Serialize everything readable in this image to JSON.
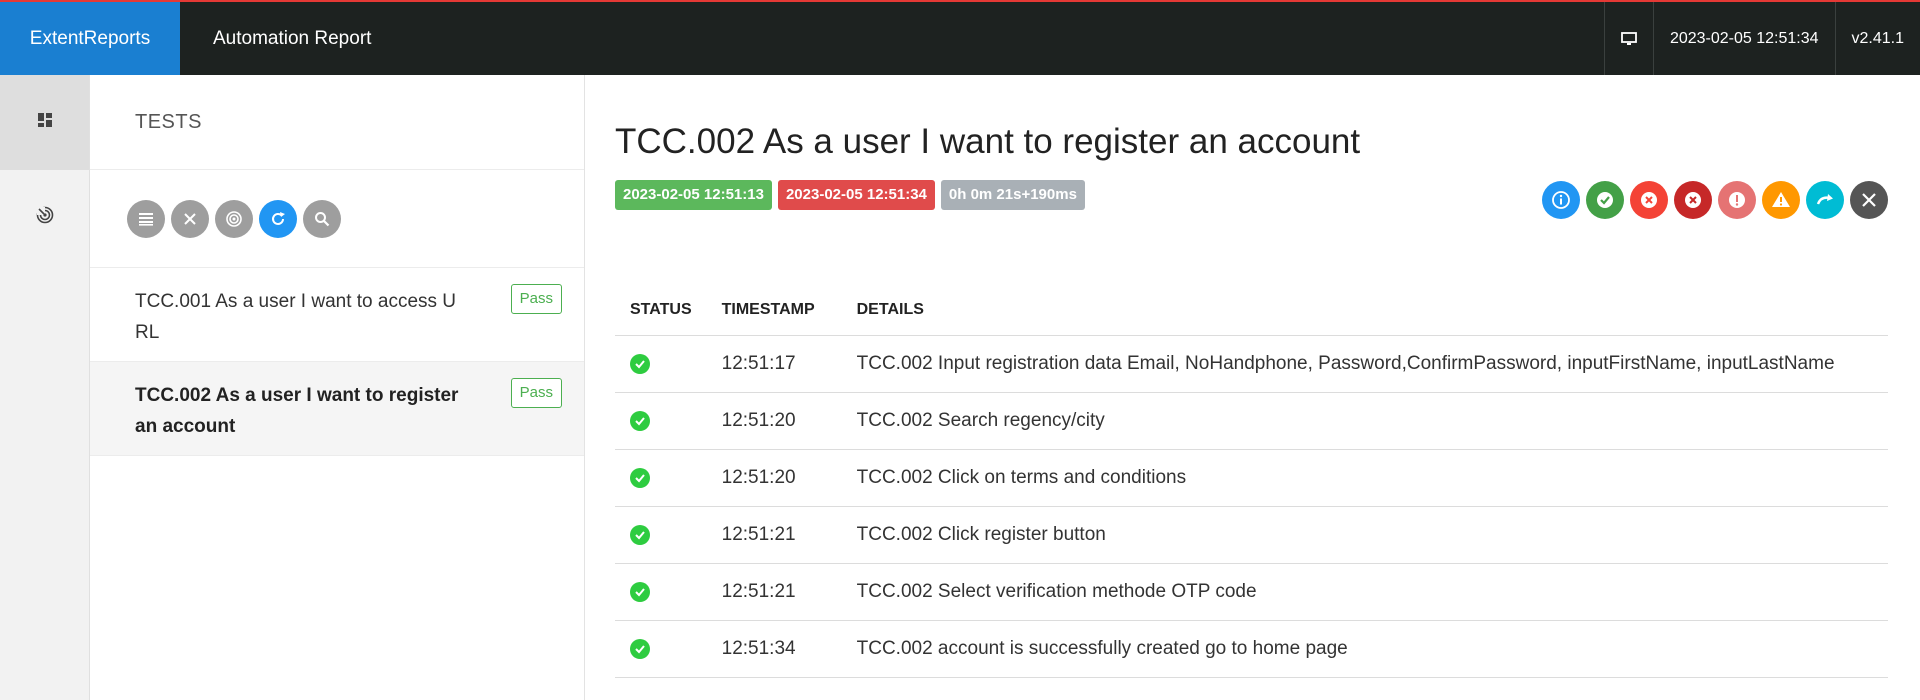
{
  "header": {
    "brand": "ExtentReports",
    "title": "Automation Report",
    "datetime": "2023-02-05 12:51:34",
    "version": "v2.41.1",
    "icons": [
      "monitor-icon"
    ]
  },
  "rail": {
    "items": [
      {
        "icon": "dashboard-icon",
        "active": true
      },
      {
        "icon": "radar-icon",
        "active": false
      }
    ]
  },
  "tests_panel": {
    "heading": "TESTS",
    "filters": [
      "list-icon",
      "close-icon",
      "radar-icon",
      "refresh-icon",
      "search-icon"
    ],
    "items": [
      {
        "name": "TCC.001 As a user I want to access URL",
        "line1": "TCC.001 As a user I want to access U",
        "line2": "RL",
        "status": "Pass"
      },
      {
        "name": "TCC.002 As a user I want to register an account",
        "line1": "TCC.002 As a user I want to register",
        "line2": "an account",
        "status": "Pass"
      }
    ]
  },
  "detail": {
    "title": "TCC.002 As a user I want to register an account",
    "start": "2023-02-05 12:51:13",
    "end": "2023-02-05 12:51:34",
    "duration": "0h 0m 21s+190ms",
    "status_filters": [
      {
        "icon": "info-icon",
        "color": "#2196f3"
      },
      {
        "icon": "pass-icon",
        "color": "#43a047"
      },
      {
        "icon": "fail-icon",
        "color": "#f44336"
      },
      {
        "icon": "fatal-icon",
        "color": "#c62828"
      },
      {
        "icon": "error-icon",
        "color": "#e57373"
      },
      {
        "icon": "warning-icon",
        "color": "#ff9800"
      },
      {
        "icon": "skip-icon",
        "color": "#00bcd4"
      },
      {
        "icon": "clear-icon",
        "color": "#555555"
      }
    ],
    "table": {
      "headers": [
        "STATUS",
        "TIMESTAMP",
        "DETAILS"
      ],
      "rows": [
        {
          "status": "pass",
          "timestamp": "12:51:17",
          "details": "TCC.002 Input registration data Email, NoHandphone, Password,ConfirmPassword, inputFirstName, inputLastName"
        },
        {
          "status": "pass",
          "timestamp": "12:51:20",
          "details": "TCC.002 Search regency/city"
        },
        {
          "status": "pass",
          "timestamp": "12:51:20",
          "details": "TCC.002 Click on terms and conditions"
        },
        {
          "status": "pass",
          "timestamp": "12:51:21",
          "details": "TCC.002 Click register button"
        },
        {
          "status": "pass",
          "timestamp": "12:51:21",
          "details": "TCC.002 Select verification methode OTP code"
        },
        {
          "status": "pass",
          "timestamp": "12:51:34",
          "details": "TCC.002 account is successfully created go to home page"
        }
      ]
    }
  }
}
